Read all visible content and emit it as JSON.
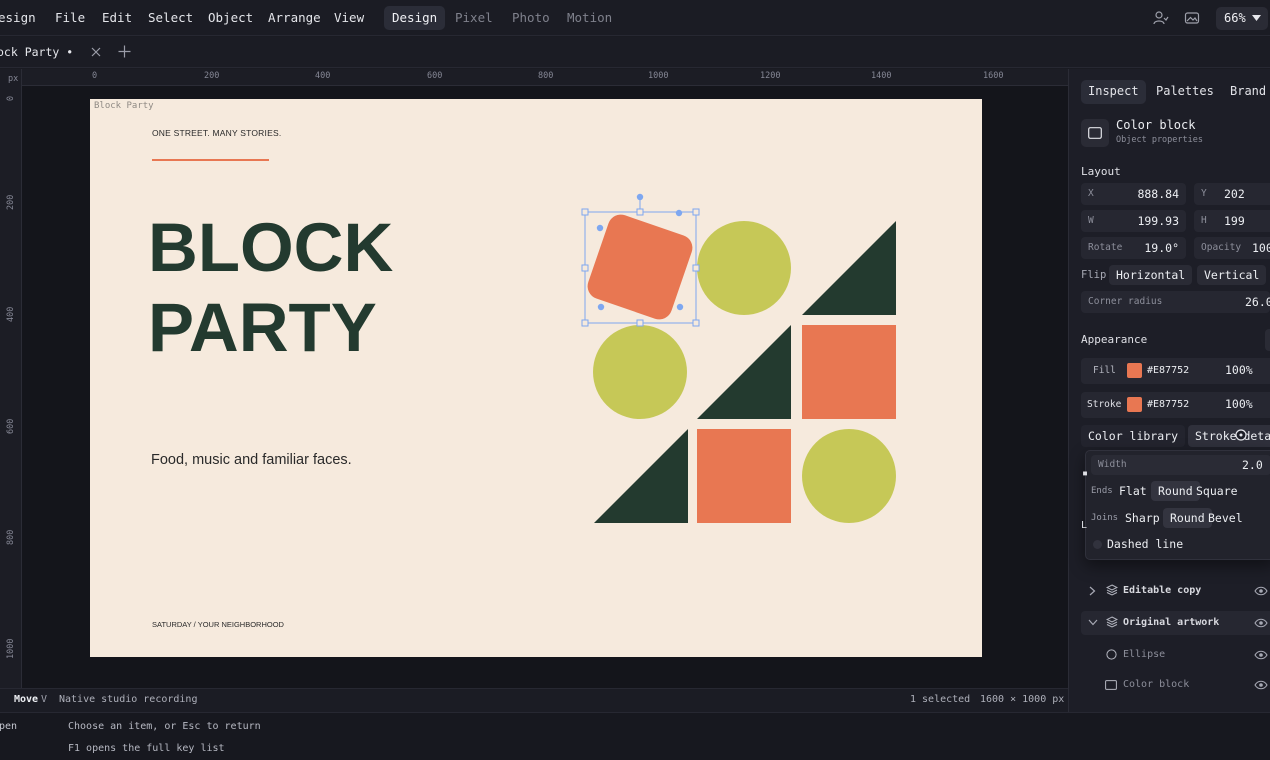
{
  "menubar": {
    "app_label": "esign",
    "menus": [
      "File",
      "Edit",
      "Select",
      "Object",
      "Arrange",
      "View"
    ],
    "modes": [
      "Design",
      "Pixel",
      "Photo",
      "Motion"
    ],
    "active_mode": "Design",
    "zoom": "66%"
  },
  "tabbar": {
    "document_tab": "ock Party •"
  },
  "ruler": {
    "unit": "px",
    "top_ticks": [
      "0",
      "200",
      "400",
      "600",
      "800",
      "1000",
      "1200",
      "1400",
      "1600"
    ],
    "left_ticks": [
      "0",
      "200",
      "400",
      "600",
      "800",
      "1000"
    ]
  },
  "artboard": {
    "name": "Block Party",
    "tagline": "ONE STREET. MANY STORIES.",
    "title_line1": "BLOCK",
    "title_line2": "PARTY",
    "subtitle": "Food, music and familiar faces.",
    "footer": "SATURDAY / YOUR NEIGHBORHOOD",
    "colors": {
      "background": "#f6eadd",
      "dark": "#233a2f",
      "orange": "#e87752",
      "olive": "#c6c857",
      "selection": "#7ea7f0"
    }
  },
  "status": {
    "tool": "Move",
    "tool_key": "V",
    "message": "Native studio recording",
    "selection": "1 selected",
    "doc_size": "1600 × 1000 px"
  },
  "cmd": {
    "left": "pen",
    "line1": "Choose an item, or Esc to return",
    "line2": "F1 opens the full key list"
  },
  "panel": {
    "tabs": [
      "Inspect",
      "Palettes",
      "Brand"
    ],
    "active_tab": "Inspect",
    "object_title": "Color block",
    "object_subtitle": "Object properties",
    "layout_title": "Layout",
    "x_label": "X",
    "x_value": "888.84",
    "y_label": "Y",
    "y_value": "202",
    "w_label": "W",
    "w_value": "199.93",
    "h_label": "H",
    "h_value": "199",
    "rotate_label": "Rotate",
    "rotate_value": "19.0°",
    "opacity_label": "Opacity",
    "opacity_value": "100",
    "flip_label": "Flip",
    "flip_horizontal": "Horizontal",
    "flip_vertical": "Vertical",
    "corner_label": "Corner radius",
    "corner_value": "26.0",
    "appearance_title": "Appearance",
    "fill_label": "Fill",
    "fill_hex": "#E87752",
    "fill_opacity": "100%",
    "stroke_label": "Stroke",
    "stroke_hex": "#E87752",
    "stroke_opacity": "100%",
    "color_library": "Color library",
    "stroke_details": "Stroke detai",
    "popover": {
      "width_label": "Width",
      "width_value": "2.0",
      "ends_label": "Ends",
      "ends": [
        "Flat",
        "Round",
        "Square"
      ],
      "ends_selected": "Round",
      "joins_label": "Joins",
      "joins": [
        "Sharp",
        "Round",
        "Bevel"
      ],
      "joins_selected": "Round",
      "dashed_label": "Dashed line"
    },
    "layers": [
      {
        "name": "Editable copy",
        "kind": "group"
      },
      {
        "name": "Original artwork",
        "kind": "group"
      },
      {
        "name": "Ellipse",
        "kind": "ellipse"
      },
      {
        "name": "Color block",
        "kind": "rect"
      }
    ]
  }
}
